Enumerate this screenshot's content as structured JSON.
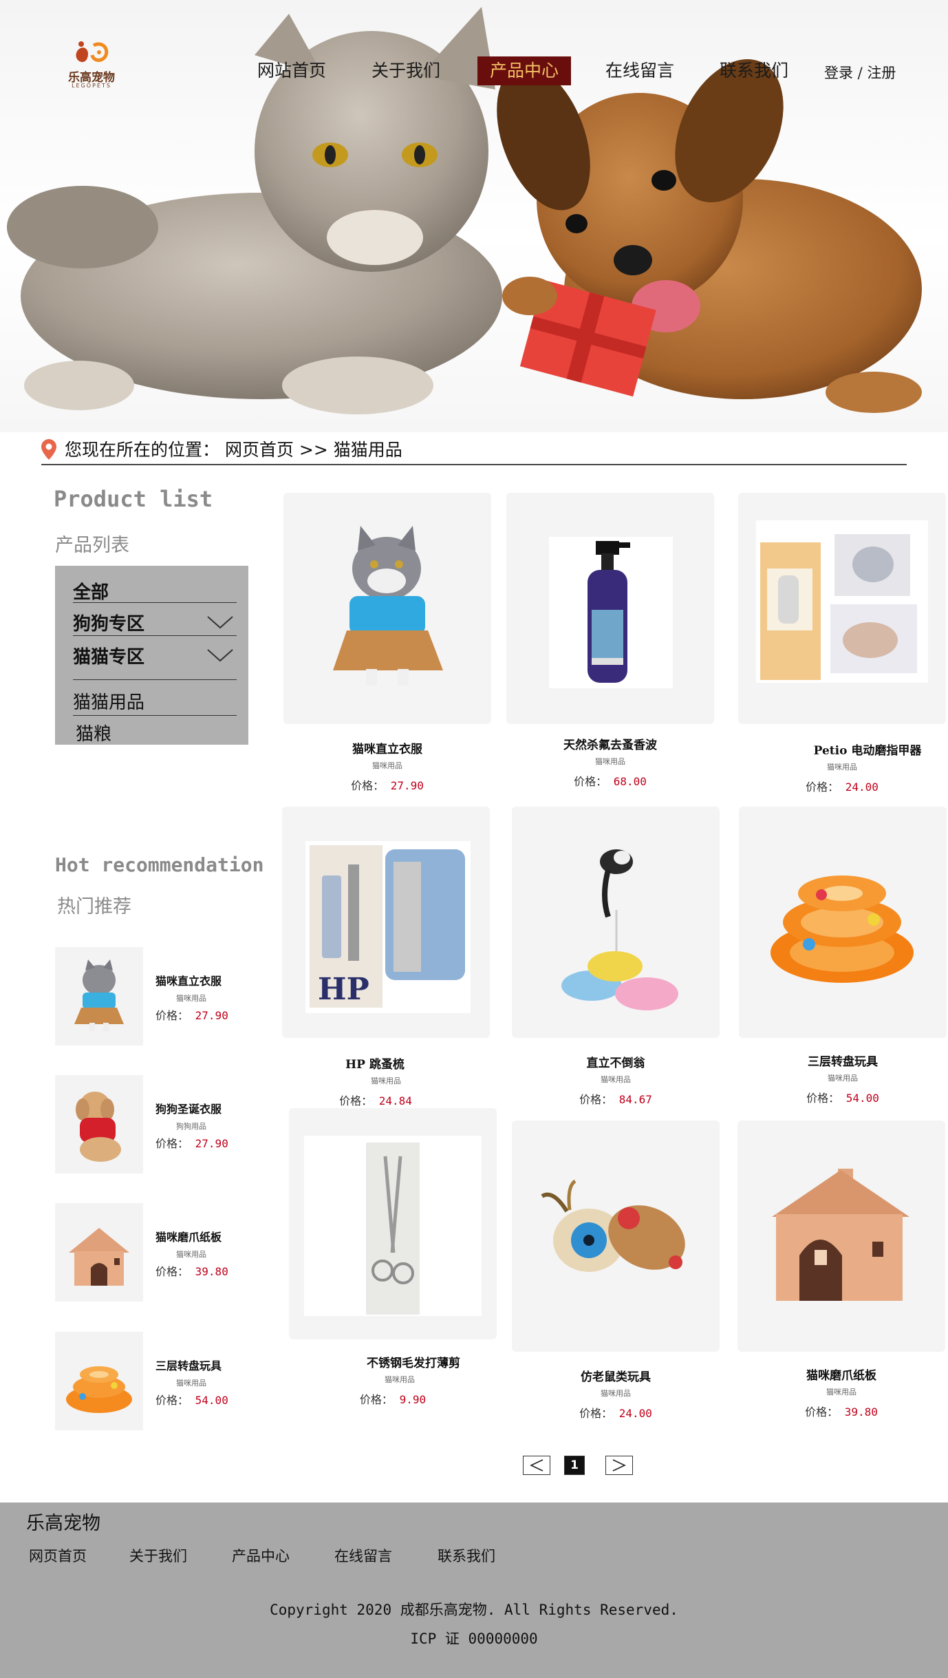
{
  "brand": {
    "name_cn": "乐高宠物",
    "name_en": "LEGOPETS"
  },
  "nav": {
    "items": [
      "网站首页",
      "关于我们",
      "产品中心",
      "在线留言",
      "联系我们"
    ],
    "active_index": 2,
    "login": "登录 / 注册"
  },
  "breadcrumb": {
    "text": "您现在所在的位置： 网页首页 >> 猫猫用品"
  },
  "sidebar": {
    "product_title_en": "Product list",
    "product_title_cn": "产品列表",
    "categories": [
      "全部",
      "狗狗专区",
      "猫猫专区",
      "猫猫用品",
      "猫粮"
    ],
    "hot_title_en": "Hot recommendation",
    "hot_title_cn": "热门推荐",
    "hot_items": [
      {
        "name": "猫咪直立衣服",
        "category": "猫咪用品",
        "price_label": "价格：",
        "price": "27.90"
      },
      {
        "name": "狗狗圣诞衣服",
        "category": "狗狗用品",
        "price_label": "价格：",
        "price": "27.90"
      },
      {
        "name": "猫咪磨爪纸板",
        "category": "猫咪用品",
        "price_label": "价格：",
        "price": "39.80"
      },
      {
        "name": "三层转盘玩具",
        "category": "猫咪用品",
        "price_label": "价格：",
        "price": "54.00"
      }
    ]
  },
  "products": [
    {
      "name": "猫咪直立衣服",
      "category": "猫咪用品",
      "price_label": "价格：",
      "price": "27.90"
    },
    {
      "name": "天然杀氟去蚤香波",
      "category": "猫咪用品",
      "price_label": "价格：",
      "price": "68.00"
    },
    {
      "name": "Petio 电动磨指甲器",
      "category": "猫咪用品",
      "price_label": "价格：",
      "price": "24.00"
    },
    {
      "name": "HP 跳蚤梳",
      "category": "猫咪用品",
      "price_label": "价格：",
      "price": "24.84"
    },
    {
      "name": "直立不倒翁",
      "category": "猫咪用品",
      "price_label": "价格：",
      "price": "84.67"
    },
    {
      "name": "三层转盘玩具",
      "category": "猫咪用品",
      "price_label": "价格：",
      "price": "54.00"
    },
    {
      "name": "不锈钢毛发打薄剪",
      "category": "猫咪用品",
      "price_label": "价格：",
      "price": "9.90"
    },
    {
      "name": "仿老鼠类玩具",
      "category": "猫咪用品",
      "price_label": "价格：",
      "price": "24.00"
    },
    {
      "name": "猫咪磨爪纸板",
      "category": "猫咪用品",
      "price_label": "价格：",
      "price": "39.80"
    }
  ],
  "pager": {
    "prev": "<",
    "current": "1",
    "next": ">"
  },
  "footer": {
    "brand": "乐高宠物",
    "links": [
      "网页首页",
      "关于我们",
      "产品中心",
      "在线留言",
      "联系我们"
    ],
    "copyright": "Copyright 2020 成都乐高宠物. All Rights Reserved.",
    "icp": "ICP 证 00000000"
  },
  "colors": {
    "nav_active_bg": "#6a0d0d",
    "nav_active_text": "#f4c266",
    "price": "#c0001a",
    "footer_bg": "#a8a8a8",
    "category_box": "#b0b0b0"
  }
}
